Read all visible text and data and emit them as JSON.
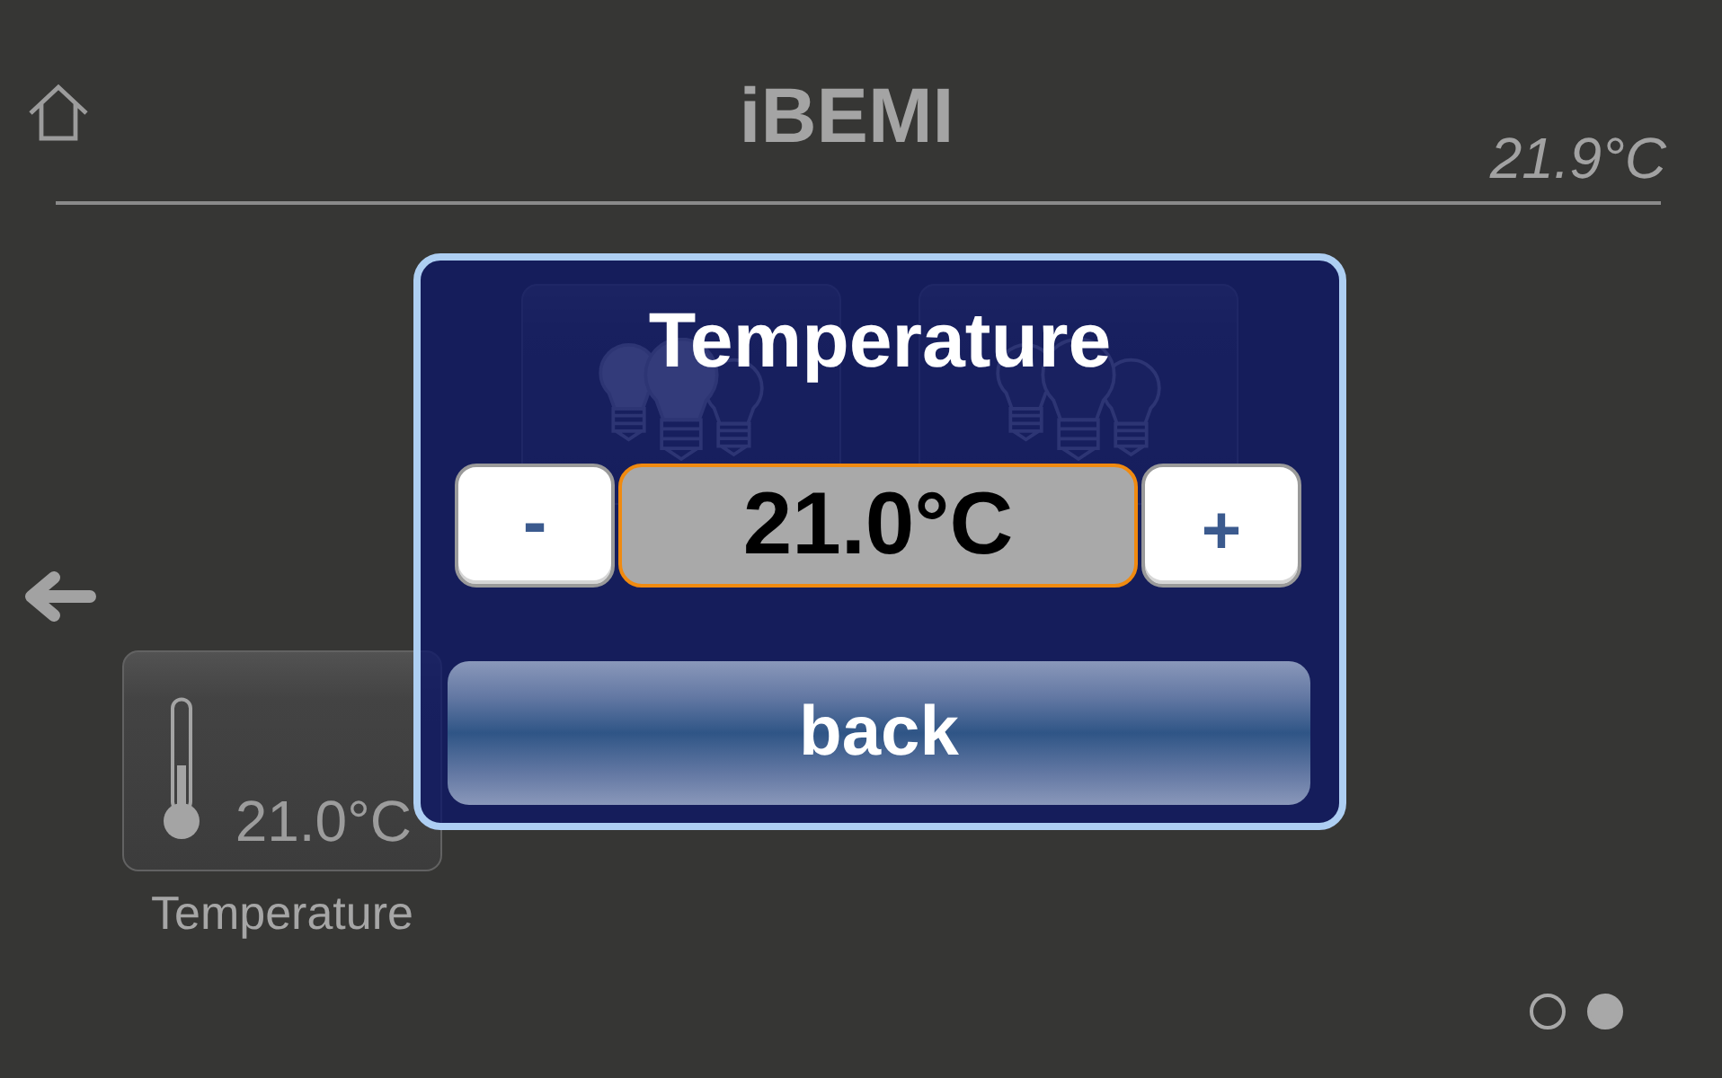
{
  "header": {
    "title": "iBEMI",
    "temperature": "21.9°C"
  },
  "tile_rows": [
    {
      "tiles": [
        {
          "kind": "light",
          "on": true
        },
        {
          "kind": "light",
          "on": false
        }
      ]
    },
    {
      "tiles": [
        {
          "kind": "temperature",
          "value": "21.0°C",
          "label": "Temperature"
        }
      ]
    }
  ],
  "pager": [
    {
      "selected": false
    },
    {
      "selected": true
    }
  ],
  "dialog": {
    "title": "Temperature",
    "decrease": "-",
    "value": "21.0°C",
    "increase": "+",
    "back": "back"
  }
}
